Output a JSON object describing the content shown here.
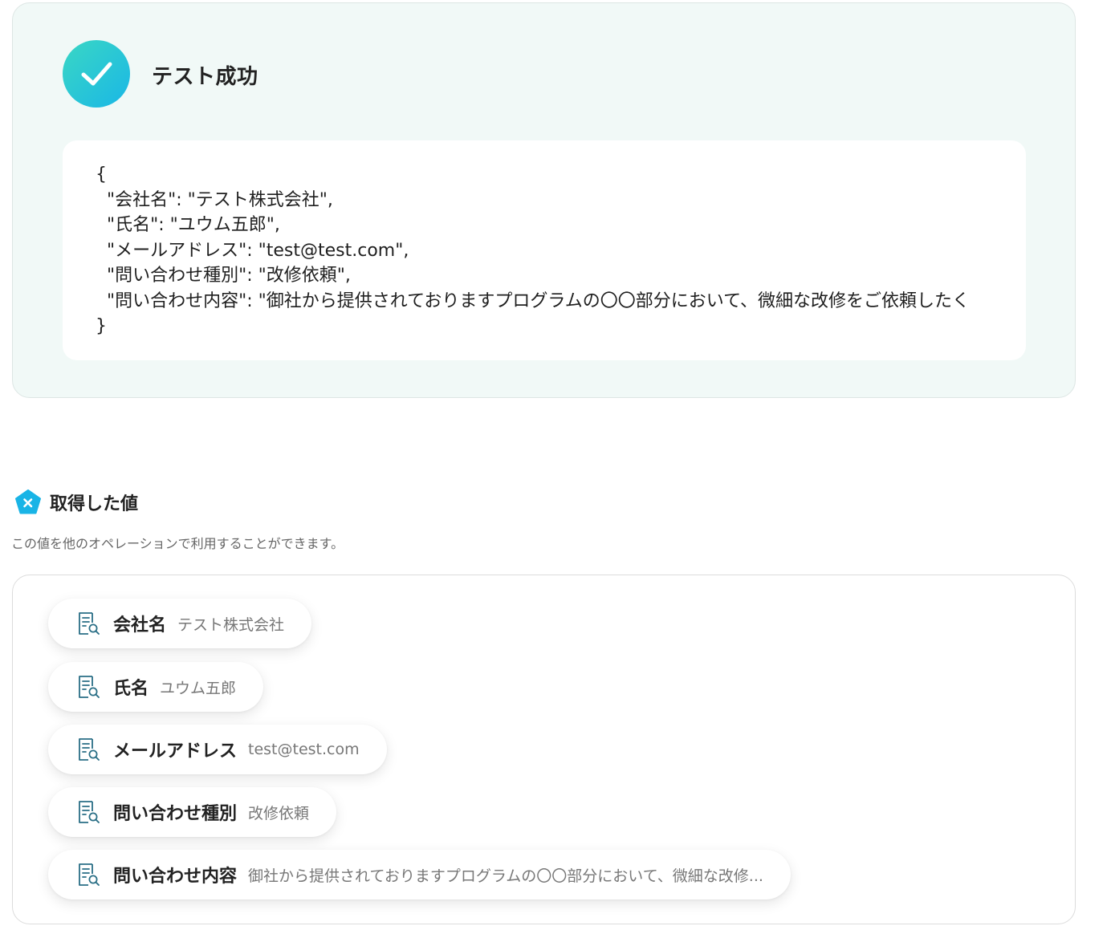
{
  "test_result": {
    "status_icon": "check-icon",
    "title": "テスト成功",
    "json_lines": [
      "{",
      "  \"会社名\": \"テスト株式会社\",",
      "  \"氏名\": \"ユウム五郎\",",
      "  \"メールアドレス\": \"test@test.com\",",
      "  \"問い合わせ種別\": \"改修依頼\",",
      "  \"問い合わせ内容\": \"御社から提供されておりますプログラムの〇〇部分において、微細な改修をご依頼したく",
      "}"
    ]
  },
  "acquired_values": {
    "icon": "pentagon-x-icon",
    "title": "取得した値",
    "description": "この値を他のオペレーションで利用することができます。",
    "items": [
      {
        "icon": "document-search-icon",
        "key": "会社名",
        "value": "テスト株式会社"
      },
      {
        "icon": "document-search-icon",
        "key": "氏名",
        "value": "ユウム五郎"
      },
      {
        "icon": "document-search-icon",
        "key": "メールアドレス",
        "value": "test@test.com"
      },
      {
        "icon": "document-search-icon",
        "key": "問い合わせ種別",
        "value": "改修依頼"
      },
      {
        "icon": "document-search-icon",
        "key": "問い合わせ内容",
        "value": "御社から提供されておりますプログラムの〇〇部分において、微細な改修..."
      }
    ]
  },
  "colors": {
    "success_card_bg": "#f1f9f7",
    "check_gradient_start": "#3ad7c4",
    "check_gradient_end": "#1ab7e6",
    "accent_blue": "#19b4e6",
    "icon_teal": "#2a6f86"
  }
}
